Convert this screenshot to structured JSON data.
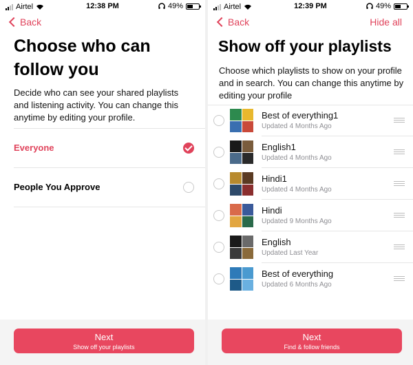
{
  "left": {
    "status": {
      "carrier": "Airtel",
      "time": "12:38 PM",
      "battery": "49%"
    },
    "nav": {
      "back_label": "Back"
    },
    "title": "Choose who can follow you",
    "description": "Decide who can see your shared playlists and listening activity. You can change this anytime by editing your profile.",
    "options": [
      {
        "label": "Everyone",
        "selected": true
      },
      {
        "label": "People You Approve",
        "selected": false
      }
    ],
    "footer": {
      "next_label": "Next",
      "next_sub": "Show off your playlists"
    }
  },
  "right": {
    "status": {
      "carrier": "Airtel",
      "time": "12:39 PM",
      "battery": "49%"
    },
    "nav": {
      "back_label": "Back",
      "hide_all_label": "Hide all"
    },
    "title": "Show off your playlists",
    "description": "Choose which playlists to show on your profile and in search. You can change this anytime by editing your profile",
    "playlists": [
      {
        "name": "Best of everything1",
        "updated": "Updated 4 Months Ago",
        "art": [
          "#2d8a4e",
          "#e8b82e",
          "#3a6fb0",
          "#c94a3a"
        ]
      },
      {
        "name": "English1",
        "updated": "Updated 4 Months Ago",
        "art": [
          "#1a1a1a",
          "#7a5c3c",
          "#4a6a8a",
          "#2a2a2a"
        ]
      },
      {
        "name": "Hindi1",
        "updated": "Updated 4 Months Ago",
        "art": [
          "#b88a2e",
          "#5a3a22",
          "#2e4a6a",
          "#8a2e2e"
        ]
      },
      {
        "name": "Hindi",
        "updated": "Updated 9 Months Ago",
        "art": [
          "#d96a4a",
          "#3a5a9a",
          "#e2a640",
          "#2a6a4a"
        ]
      },
      {
        "name": "English",
        "updated": "Updated Last Year",
        "art": [
          "#1a1a1a",
          "#6a6a6a",
          "#3a3a3a",
          "#8a6a3a"
        ]
      },
      {
        "name": "Best of everything",
        "updated": "Updated 6 Months Ago",
        "art": [
          "#2e7ab8",
          "#4a9ad0",
          "#1e5a88",
          "#6ab0e0"
        ]
      }
    ],
    "footer": {
      "next_label": "Next",
      "next_sub": "Find & follow friends"
    }
  },
  "colors": {
    "accent": "#e0435b",
    "button": "#e8475f"
  }
}
